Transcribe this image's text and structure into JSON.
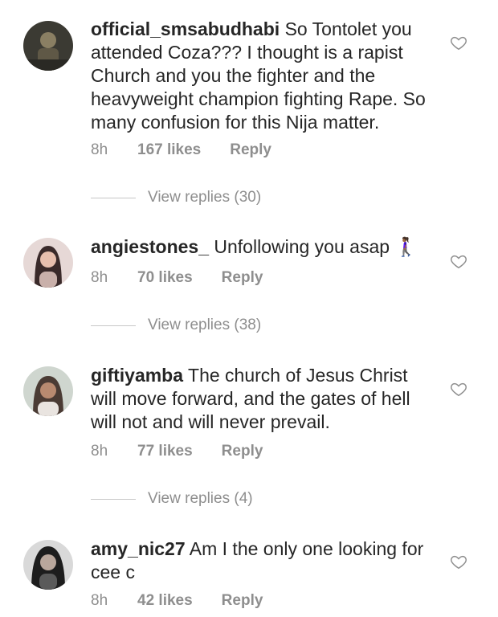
{
  "comments": [
    {
      "username": "official_smsabudhabi",
      "text": "So Tontolet you attended Coza??? I thought is a rapist Church and you the fighter and the heavyweight champion fighting Rape. So many confusion for this Nija matter.",
      "time": "8h",
      "likes": "167 likes",
      "reply": "Reply",
      "view_replies": "View replies (30)"
    },
    {
      "username": "angiestones_",
      "text": "Unfollowing you asap 🚶🏾‍♀️",
      "time": "8h",
      "likes": "70 likes",
      "reply": "Reply",
      "view_replies": "View replies (38)"
    },
    {
      "username": "giftiyamba",
      "text": "The church of Jesus Christ will move forward, and the gates of hell will not and will never prevail.",
      "time": "8h",
      "likes": "77 likes",
      "reply": "Reply",
      "view_replies": "View replies (4)"
    },
    {
      "username": "amy_nic27",
      "text": "Am I the only one looking for cee c",
      "time": "8h",
      "likes": "42 likes",
      "reply": "Reply"
    }
  ],
  "icons": {
    "like": "heart-icon",
    "avatar": "avatar"
  },
  "colors": {
    "text": "#262626",
    "meta": "#8e8e8e",
    "divider": "#c7c7c7"
  }
}
